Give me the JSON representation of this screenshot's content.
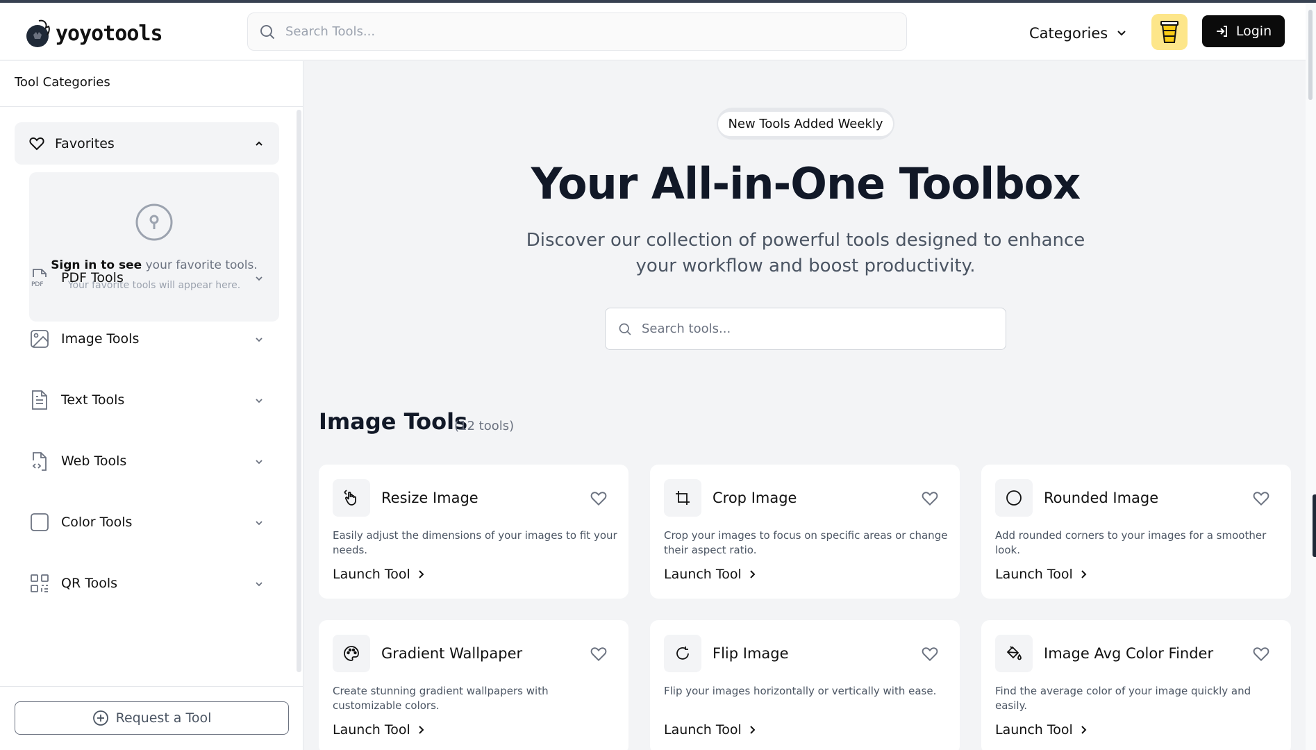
{
  "header": {
    "logo_text": "yoyotools",
    "search_placeholder": "Search Tools...",
    "categories_label": "Categories",
    "login_label": "Login"
  },
  "sidebar": {
    "title": "Tool Categories",
    "favorites": {
      "label": "Favorites",
      "signin_bold": "Sign in to see",
      "signin_rest": " your favorite tools.",
      "hint": "Your favorite tools will appear here."
    },
    "items": [
      {
        "label": "PDF Tools",
        "icon": "pdf-file-icon"
      },
      {
        "label": "Image Tools",
        "icon": "image-icon"
      },
      {
        "label": "Text Tools",
        "icon": "text-file-icon"
      },
      {
        "label": "Web Tools",
        "icon": "code-file-icon"
      },
      {
        "label": "Color Tools",
        "icon": "square-icon"
      },
      {
        "label": "QR Tools",
        "icon": "qr-code-icon"
      }
    ],
    "request_label": "Request a Tool"
  },
  "hero": {
    "badge": "New Tools Added Weekly",
    "title": "Your All-in-One Toolbox",
    "subtitle": "Discover our collection of powerful tools designed to enhance your workflow and boost productivity.",
    "search_placeholder": "Search tools..."
  },
  "section": {
    "title": "Image Tools",
    "count": "(12 tools)"
  },
  "cards": [
    {
      "title": "Resize Image",
      "desc": "Easily adjust the dimensions of your images to fit your needs.",
      "launch": "Launch Tool",
      "icon": "resize-hand-icon"
    },
    {
      "title": "Crop Image",
      "desc": "Crop your images to focus on specific areas or change their aspect ratio.",
      "launch": "Launch Tool",
      "icon": "crop-icon"
    },
    {
      "title": "Rounded Image",
      "desc": "Add rounded corners to your images for a smoother look.",
      "launch": "Launch Tool",
      "icon": "circle-icon"
    },
    {
      "title": "Gradient Wallpaper",
      "desc": "Create stunning gradient wallpapers with customizable colors.",
      "launch": "Launch Tool",
      "icon": "palette-icon"
    },
    {
      "title": "Flip Image",
      "desc": "Flip your images horizontally or vertically with ease.",
      "launch": "Launch Tool",
      "icon": "rotate-icon"
    },
    {
      "title": "Image Avg Color Finder",
      "desc": "Find the average color of your image quickly and easily.",
      "launch": "Launch Tool",
      "icon": "paint-bucket-icon"
    }
  ],
  "colors": {
    "accent_dark": "#0b0b0b",
    "coffee_bg": "#fde68a",
    "page_bg": "#f3f4f6"
  }
}
